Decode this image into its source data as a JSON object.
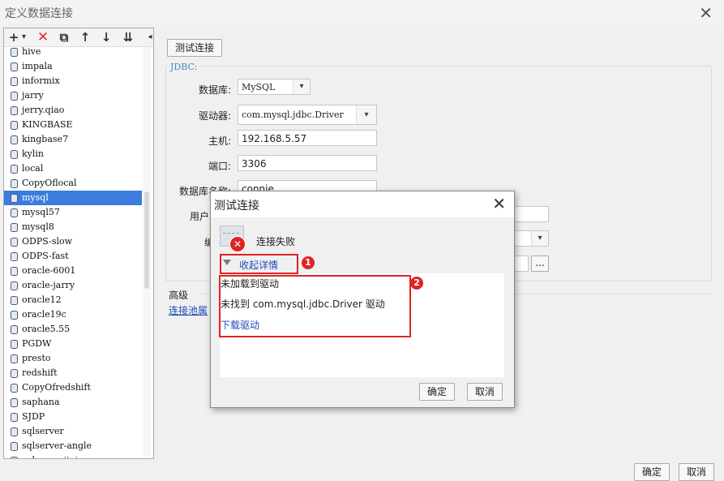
{
  "window": {
    "title": "定义数据连接",
    "close_glyph": "✕"
  },
  "toolbar": {
    "add": "+",
    "add_menu": "▾",
    "delete": "✕",
    "copy": "⧉",
    "move_up": "↑",
    "move_down": "↓",
    "sort": "⇊",
    "collapse": "◂"
  },
  "tree": {
    "items": [
      "hive",
      "impala",
      "informix",
      "jarry",
      "jerry.qiao",
      "KINGBASE",
      "kingbase7",
      "kylin",
      "local",
      "CopyOflocal",
      "mysql",
      "mysql57",
      "mysql8",
      "ODPS-slow",
      "ODPS-fast",
      "oracle-6001",
      "oracle-jarry",
      "oracle12",
      "oracle19c",
      "oracle5.55",
      "PGDW",
      "presto",
      "redshift",
      "CopyOfredshift",
      "saphana",
      "SJDP",
      "sqlserver",
      "sqlserver-angle",
      "sqlserverjiqiao"
    ],
    "selected": "mysql"
  },
  "form": {
    "test_button": "测试连接",
    "legend": "JDBC:",
    "db_label": "数据库:",
    "db_value": "MySQL",
    "driver_label": "驱动器:",
    "driver_value": "com.mysql.jdbc.Driver",
    "host_label": "主机:",
    "host_value": "192.168.5.57",
    "port_label": "端口:",
    "port_value": "3306",
    "dbname_label": "数据库名称:",
    "dbname_value": "connie",
    "user_label_partial": "用户",
    "enc_label_partial": "编",
    "browse_label": "...",
    "advanced_label": "高级",
    "conn_link_partial": "连接池属"
  },
  "dialog": {
    "title": "测试连接",
    "close_glyph": "✕",
    "status_text": "连接失败",
    "error_glyph": "✕",
    "collapse_label": "收起详情",
    "detail_line1": "未加载到驱动",
    "detail_line2": "未找到 com.mysql.jdbc.Driver 驱动",
    "download_link": "下载驱动",
    "ok": "确定",
    "cancel": "取消"
  },
  "footer": {
    "ok": "确定",
    "cancel": "取消"
  },
  "annotations": {
    "callout1": "1",
    "callout2": "2"
  },
  "colors": {
    "selection": "#3b7ddd",
    "link": "#1e4ab8",
    "error": "#e02424",
    "legend": "#3c8dbc"
  }
}
